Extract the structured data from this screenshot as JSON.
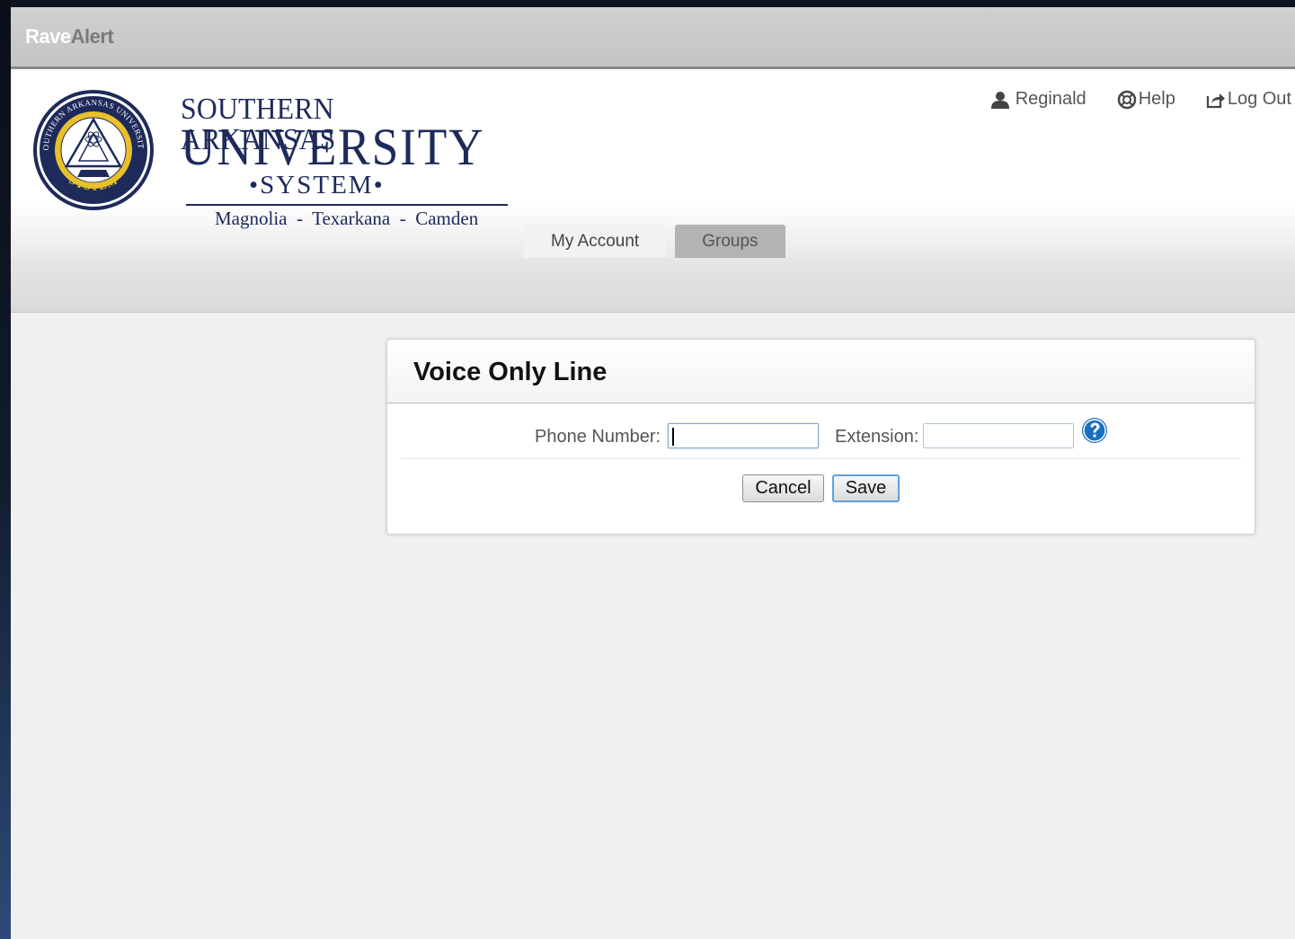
{
  "app": {
    "brand_part1": "Rave",
    "brand_part2": "Alert"
  },
  "logo": {
    "line1": "SOUTHERN ARKANSAS",
    "line2": "UNIVERSITY",
    "line3": "•SYSTEM•",
    "line4": "Magnolia  -  Texarkana  -  Camden",
    "seal_top_text": "SOUTHERN ARKANSAS UNIVERSITY",
    "seal_bottom_text": "SYSTEM"
  },
  "user_nav": {
    "user_label": "Reginald",
    "help_label": "Help",
    "logout_label": "Log Out"
  },
  "tabs": [
    {
      "label": "My Account",
      "active": true
    },
    {
      "label": "Groups",
      "active": false
    }
  ],
  "panel": {
    "title": "Voice Only Line",
    "phone_label": "Phone Number:",
    "phone_value": "",
    "extension_label": "Extension:",
    "extension_value": "",
    "cancel_label": "Cancel",
    "save_label": "Save"
  },
  "colors": {
    "brand_navy": "#1d2a5a",
    "seal_gold": "#e8c12a",
    "help_blue": "#1a6fc2",
    "focus_border": "#5ea2d8"
  }
}
